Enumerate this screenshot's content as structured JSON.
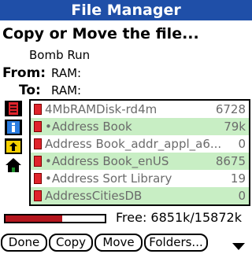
{
  "app": {
    "title": "File Manager"
  },
  "heading": "Copy or Move the file...",
  "file_name": "Bomb Run",
  "from": {
    "label": "From:",
    "value": "RAM:"
  },
  "to": {
    "label": "To:",
    "value": "RAM:"
  },
  "files": [
    {
      "name": "4MbRAMDisk-rd4m",
      "size": "6728",
      "highlighted": false,
      "dot": false
    },
    {
      "name": "•Address Book",
      "size": "79k",
      "highlighted": true,
      "dot": true
    },
    {
      "name": "Address Book_addr_appl_a6...",
      "size": "0",
      "highlighted": false,
      "dot": false
    },
    {
      "name": "•Address Book_enUS",
      "size": "8675",
      "highlighted": true,
      "dot": true
    },
    {
      "name": "•Address Sort Library",
      "size": "19",
      "highlighted": false,
      "dot": true
    },
    {
      "name": "AddressCitiesDB",
      "size": "0",
      "highlighted": true,
      "dot": false
    }
  ],
  "memory": {
    "free_text": "Free: 6851k/15872k",
    "used_fraction": 0.57
  },
  "buttons": {
    "done": "Done",
    "copy": "Copy",
    "move": "Move",
    "folders": "Folders..."
  },
  "icons": [
    "file-icon",
    "info-icon",
    "folder-up-icon",
    "home-icon",
    "scroll-down-arrow-icon"
  ],
  "colors": {
    "titlebar": "#1f4fa8",
    "highlight": "#c8eec4",
    "file_square": "#e0242c",
    "bar_fill": "#b4151d"
  }
}
